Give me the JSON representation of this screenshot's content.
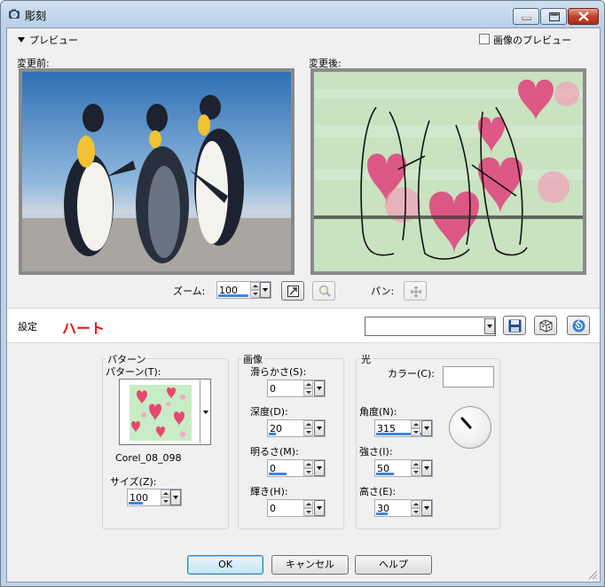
{
  "window": {
    "title": "彫刻",
    "icon": "app-icon",
    "minimize_icon": "minimize-icon",
    "maximize_icon": "maximize-icon",
    "close_icon": "close-icon"
  },
  "preview": {
    "toggle_label": "プレビュー",
    "image_preview_label": "画像のプレビュー",
    "image_preview_checked": false,
    "before_label": "変更前:",
    "after_label": "変更後:"
  },
  "zoom": {
    "label": "ズーム:",
    "value": "100",
    "fit_icon": "fit-window-icon",
    "magnifier_icon": "magnifier-icon",
    "pan_label": "パン:",
    "pan_icon": "move-icon"
  },
  "settings": {
    "label": "設定",
    "preset_name": "ハート",
    "preset_value": "",
    "save_icon": "save-icon",
    "random_icon": "dice-icon",
    "reset_icon": "reset-icon"
  },
  "pattern_group": {
    "title": "パターン",
    "pattern_label": "パターン(T):",
    "pattern_name": "Corel_08_098",
    "size_label": "サイズ(Z):",
    "size_value": "100",
    "size_fill": 0.45
  },
  "image_group": {
    "title": "画像",
    "smoothness_label": "滑らかさ(S):",
    "smoothness_value": "0",
    "smoothness_fill": 0.0,
    "depth_label": "深度(D):",
    "depth_value": "20",
    "depth_fill": 0.2,
    "ambience_label": "明るさ(M):",
    "ambience_value": "0",
    "ambience_fill": 0.5,
    "shininess_label": "輝き(H):",
    "shininess_value": "0",
    "shininess_fill": 0.0
  },
  "light_group": {
    "title": "光",
    "color_label": "カラー(C):",
    "color_value": "#ffffff",
    "angle_label": "角度(N):",
    "angle_value": "315",
    "angle_fill": 0.875,
    "strength_label": "強さ(I):",
    "strength_value": "50",
    "strength_fill": 0.5,
    "elevation_label": "高さ(E):",
    "elevation_value": "30",
    "elevation_fill": 0.33
  },
  "buttons": {
    "ok": "OK",
    "cancel": "キャンセル",
    "help": "ヘルプ"
  }
}
